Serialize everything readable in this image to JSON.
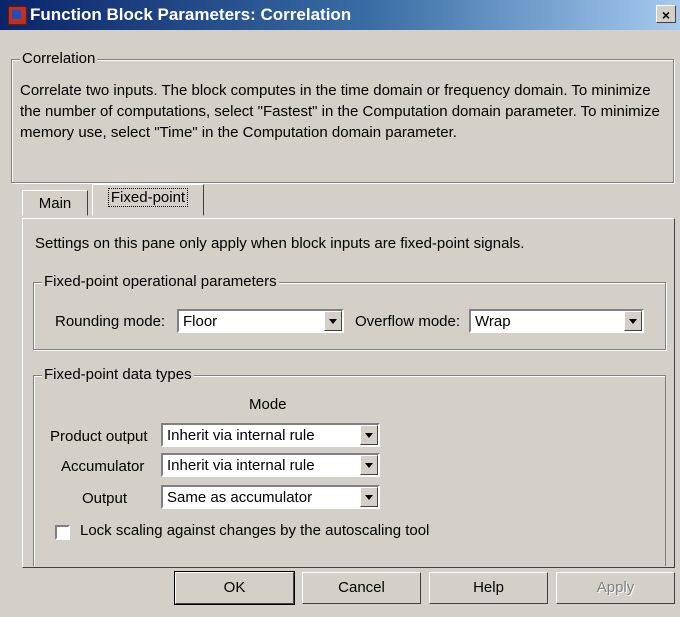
{
  "window": {
    "title": "Function Block Parameters: Correlation",
    "close_label": "×"
  },
  "correlation": {
    "legend": "Correlation",
    "description": "Correlate two inputs. The block computes in the time domain or frequency domain. To minimize the number of computations, select \"Fastest\" in the Computation domain parameter. To minimize memory use, select \"Time\" in the Computation domain parameter."
  },
  "tabs": [
    {
      "label": "Main",
      "active": false
    },
    {
      "label": "Fixed-point",
      "active": true
    }
  ],
  "panel": {
    "info": "Settings on this pane only apply when block inputs are fixed-point signals.",
    "operational": {
      "legend": "Fixed-point operational parameters",
      "rounding_label": "Rounding mode:",
      "rounding_value": "Floor",
      "overflow_label": "Overflow mode:",
      "overflow_value": "Wrap"
    },
    "datatypes": {
      "legend": "Fixed-point data types",
      "mode_header": "Mode",
      "rows": [
        {
          "label": "Product output",
          "value": "Inherit via internal rule"
        },
        {
          "label": "Accumulator",
          "value": "Inherit via internal rule"
        },
        {
          "label": "Output",
          "value": "Same as accumulator"
        }
      ],
      "lock_label": "Lock scaling against changes by the autoscaling tool",
      "lock_checked": false
    }
  },
  "buttons": {
    "ok": "OK",
    "cancel": "Cancel",
    "help": "Help",
    "apply": "Apply"
  },
  "colors": {
    "titlebar_start": "#0a246a",
    "titlebar_end": "#a6caf0",
    "face": "#d4d0c8"
  }
}
